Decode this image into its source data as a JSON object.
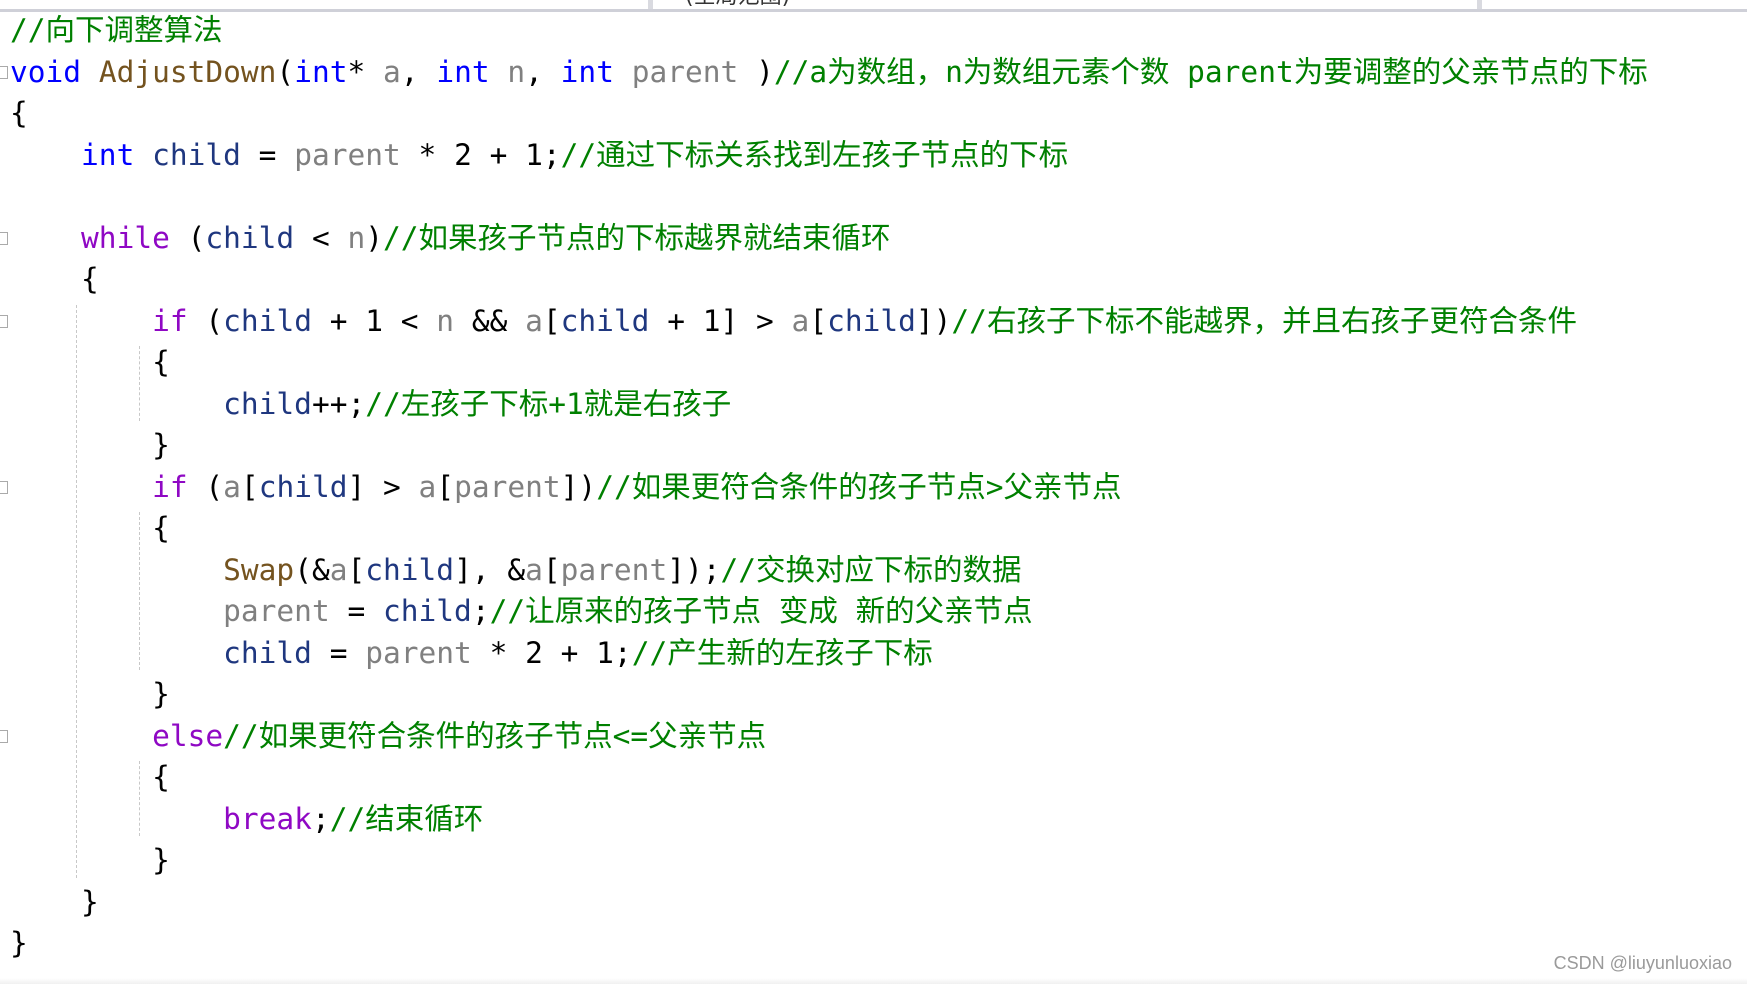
{
  "scope_dropdown": "(全局范围)",
  "watermark": "CSDN @liuyunluoxiao",
  "colors": {
    "keyword": "#0000ff",
    "control": "#8f08c4",
    "function": "#74531f",
    "parameter": "#808080",
    "local": "#1f377f",
    "comment": "#008000"
  },
  "lines": [
    {
      "fold": false,
      "tokens": [
        [
          "cmt",
          "//向下调整算法"
        ]
      ]
    },
    {
      "fold": true,
      "tokens": [
        [
          "kw",
          "void"
        ],
        [
          "pl",
          " "
        ],
        [
          "fn",
          "AdjustDown"
        ],
        [
          "pl",
          "("
        ],
        [
          "kw",
          "int"
        ],
        [
          "pl",
          "* "
        ],
        [
          "par",
          "a"
        ],
        [
          "pl",
          ", "
        ],
        [
          "kw",
          "int"
        ],
        [
          "pl",
          " "
        ],
        [
          "par",
          "n"
        ],
        [
          "pl",
          ", "
        ],
        [
          "kw",
          "int"
        ],
        [
          "pl",
          " "
        ],
        [
          "par",
          "parent"
        ],
        [
          "pl",
          " )"
        ],
        [
          "cmt",
          "//a为数组，n为数组元素个数 parent为要调整的父亲节点的下标"
        ]
      ]
    },
    {
      "fold": false,
      "tokens": [
        [
          "pl",
          "{"
        ]
      ]
    },
    {
      "fold": false,
      "tokens": [
        [
          "pl",
          "    "
        ],
        [
          "kw",
          "int"
        ],
        [
          "pl",
          " "
        ],
        [
          "var",
          "child"
        ],
        [
          "pl",
          " = "
        ],
        [
          "par",
          "parent"
        ],
        [
          "pl",
          " * 2 + 1;"
        ],
        [
          "cmt",
          "//通过下标关系找到左孩子节点的下标"
        ]
      ]
    },
    {
      "fold": false,
      "tokens": []
    },
    {
      "fold": true,
      "tokens": [
        [
          "pl",
          "    "
        ],
        [
          "kw2",
          "while"
        ],
        [
          "pl",
          " ("
        ],
        [
          "var",
          "child"
        ],
        [
          "pl",
          " < "
        ],
        [
          "par",
          "n"
        ],
        [
          "pl",
          ")"
        ],
        [
          "cmt",
          "//如果孩子节点的下标越界就结束循环"
        ]
      ]
    },
    {
      "fold": false,
      "tokens": [
        [
          "pl",
          "    {"
        ]
      ]
    },
    {
      "fold": true,
      "tokens": [
        [
          "pl",
          "        "
        ],
        [
          "kw2",
          "if"
        ],
        [
          "pl",
          " ("
        ],
        [
          "var",
          "child"
        ],
        [
          "pl",
          " + 1 < "
        ],
        [
          "par",
          "n"
        ],
        [
          "pl",
          " && "
        ],
        [
          "par",
          "a"
        ],
        [
          "pl",
          "["
        ],
        [
          "var",
          "child"
        ],
        [
          "pl",
          " + 1] > "
        ],
        [
          "par",
          "a"
        ],
        [
          "pl",
          "["
        ],
        [
          "var",
          "child"
        ],
        [
          "pl",
          "])"
        ],
        [
          "cmt",
          "//右孩子下标不能越界，并且右孩子更符合条件"
        ]
      ]
    },
    {
      "fold": false,
      "tokens": [
        [
          "pl",
          "        {"
        ]
      ]
    },
    {
      "fold": false,
      "tokens": [
        [
          "pl",
          "            "
        ],
        [
          "var",
          "child"
        ],
        [
          "pl",
          "++;"
        ],
        [
          "cmt",
          "//左孩子下标+1就是右孩子"
        ]
      ]
    },
    {
      "fold": false,
      "tokens": [
        [
          "pl",
          "        }"
        ]
      ]
    },
    {
      "fold": true,
      "tokens": [
        [
          "pl",
          "        "
        ],
        [
          "kw2",
          "if"
        ],
        [
          "pl",
          " ("
        ],
        [
          "par",
          "a"
        ],
        [
          "pl",
          "["
        ],
        [
          "var",
          "child"
        ],
        [
          "pl",
          "] > "
        ],
        [
          "par",
          "a"
        ],
        [
          "pl",
          "["
        ],
        [
          "par",
          "parent"
        ],
        [
          "pl",
          "])"
        ],
        [
          "cmt",
          "//如果更符合条件的孩子节点>父亲节点"
        ]
      ]
    },
    {
      "fold": false,
      "tokens": [
        [
          "pl",
          "        {"
        ]
      ]
    },
    {
      "fold": false,
      "tokens": [
        [
          "pl",
          "            "
        ],
        [
          "fn",
          "Swap"
        ],
        [
          "pl",
          "(&"
        ],
        [
          "par",
          "a"
        ],
        [
          "pl",
          "["
        ],
        [
          "var",
          "child"
        ],
        [
          "pl",
          "], &"
        ],
        [
          "par",
          "a"
        ],
        [
          "pl",
          "["
        ],
        [
          "par",
          "parent"
        ],
        [
          "pl",
          "]);"
        ],
        [
          "cmt",
          "//交换对应下标的数据"
        ]
      ]
    },
    {
      "fold": false,
      "tokens": [
        [
          "pl",
          "            "
        ],
        [
          "par",
          "parent"
        ],
        [
          "pl",
          " = "
        ],
        [
          "var",
          "child"
        ],
        [
          "pl",
          ";"
        ],
        [
          "cmt",
          "//让原来的孩子节点 变成 新的父亲节点"
        ]
      ]
    },
    {
      "fold": false,
      "tokens": [
        [
          "pl",
          "            "
        ],
        [
          "var",
          "child"
        ],
        [
          "pl",
          " = "
        ],
        [
          "par",
          "parent"
        ],
        [
          "pl",
          " * 2 + 1;"
        ],
        [
          "cmt",
          "//产生新的左孩子下标"
        ]
      ]
    },
    {
      "fold": false,
      "tokens": [
        [
          "pl",
          "        }"
        ]
      ]
    },
    {
      "fold": true,
      "tokens": [
        [
          "pl",
          "        "
        ],
        [
          "kw2",
          "else"
        ],
        [
          "cmt",
          "//如果更符合条件的孩子节点<=父亲节点"
        ]
      ]
    },
    {
      "fold": false,
      "tokens": [
        [
          "pl",
          "        {"
        ]
      ]
    },
    {
      "fold": false,
      "tokens": [
        [
          "pl",
          "            "
        ],
        [
          "kw2",
          "break"
        ],
        [
          "pl",
          ";"
        ],
        [
          "cmt",
          "//结束循环"
        ]
      ]
    },
    {
      "fold": false,
      "tokens": [
        [
          "pl",
          "        }"
        ]
      ]
    },
    {
      "fold": false,
      "tokens": [
        [
          "pl",
          "    }"
        ]
      ]
    },
    {
      "fold": false,
      "tokens": [
        [
          "pl",
          "}"
        ]
      ]
    }
  ]
}
